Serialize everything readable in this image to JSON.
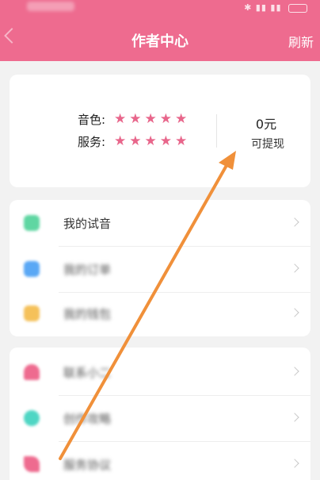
{
  "header": {
    "title": "作者中心",
    "refresh_label": "刷新",
    "background_color": "#ee6b8f"
  },
  "rating": {
    "voice_label": "音色:",
    "service_label": "服务:",
    "voice_stars": 5,
    "service_stars": 5,
    "star_color": "#e8668b"
  },
  "balance": {
    "value": "0元",
    "label": "可提现"
  },
  "menu_group_1": [
    {
      "label": "我的试音",
      "icon": "audition-icon",
      "icon_color": "#5fd6a2"
    },
    {
      "label": "我的订单",
      "icon": "orders-icon",
      "icon_color": "#5aa8f5"
    },
    {
      "label": "我的钱包",
      "icon": "wallet-icon",
      "icon_color": "#f5c15a"
    }
  ],
  "menu_group_2": [
    {
      "label": "联系小二",
      "icon": "contact-icon",
      "icon_color": "#ee6b8f"
    },
    {
      "label": "创作攻略",
      "icon": "guide-icon",
      "icon_color": "#4fd6c4"
    },
    {
      "label": "服务协议",
      "icon": "agreement-icon",
      "icon_color": "#ee6b8f"
    }
  ],
  "annotation_color": "#f0903a"
}
